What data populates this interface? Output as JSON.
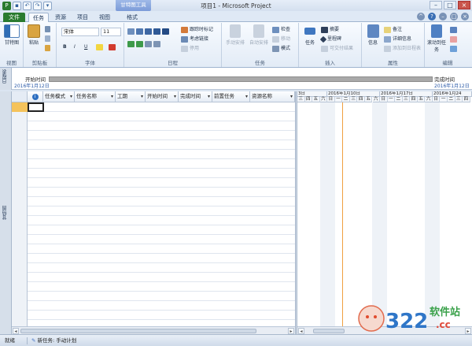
{
  "window": {
    "title": "项目1 - Microsoft Project",
    "context_tab": "甘特图工具"
  },
  "tabs": {
    "file": "文件",
    "items": [
      "任务",
      "资源",
      "项目",
      "视图",
      "格式"
    ]
  },
  "ribbon": {
    "view_group": {
      "label": "视图",
      "gantt_button": "甘特图"
    },
    "clipboard": {
      "label": "剪贴板",
      "paste": "粘贴"
    },
    "font": {
      "label": "字体",
      "family": "宋体",
      "size": "11",
      "bold": "B",
      "italic": "I",
      "underline": "U"
    },
    "schedule": {
      "label": "日程",
      "mark_on_track": "跟踪时标记",
      "respect_links": "考虑链接",
      "inactivate": "停用"
    },
    "tasks": {
      "label": "任务",
      "manual": "手动安排",
      "auto": "自动安排",
      "inspect": "检查",
      "move": "移动",
      "mode": "模式"
    },
    "insert": {
      "label": "插入",
      "task": "任务",
      "summary": "摘要",
      "milestone": "里程碑",
      "deliverable": "可交付结果"
    },
    "properties": {
      "label": "属性",
      "info": "信息",
      "notes": "备注",
      "details": "详细信息",
      "add_to_timeline": "添加到日程表"
    },
    "editing": {
      "label": "编辑",
      "scroll_to_task": "滚动到任务"
    }
  },
  "timeline": {
    "side_label": "日程表",
    "start_label": "开始时间",
    "start_date": "2016年1月12日",
    "finish_label": "完成时间",
    "finish_date": "2016年1月12日"
  },
  "gantt_side_label": "甘特图",
  "grid": {
    "columns": [
      "任务模式",
      "任务名称",
      "工期",
      "开始时间",
      "完成时间",
      "前置任务",
      "资源名称"
    ]
  },
  "gantt_header": {
    "weeks": [
      "3日",
      "2016年1月10日",
      "2016年1月17日",
      "2016年1月24"
    ],
    "days": [
      "三",
      "四",
      "五",
      "六",
      "日",
      "一",
      "二",
      "三",
      "四",
      "五",
      "六",
      "日",
      "一",
      "二",
      "三",
      "四",
      "五",
      "六",
      "日",
      "一",
      "二",
      "三",
      "四"
    ]
  },
  "status": {
    "ready": "就绪",
    "new_tasks": "新任务: 手动计划"
  },
  "watermark": {
    "text": "软件站",
    "url": ".cc",
    "number": "322"
  },
  "colors": {
    "file_tab": "#2a7b2f",
    "timeline_bar": "#a9a9a9",
    "today_line": "#f0a040"
  }
}
